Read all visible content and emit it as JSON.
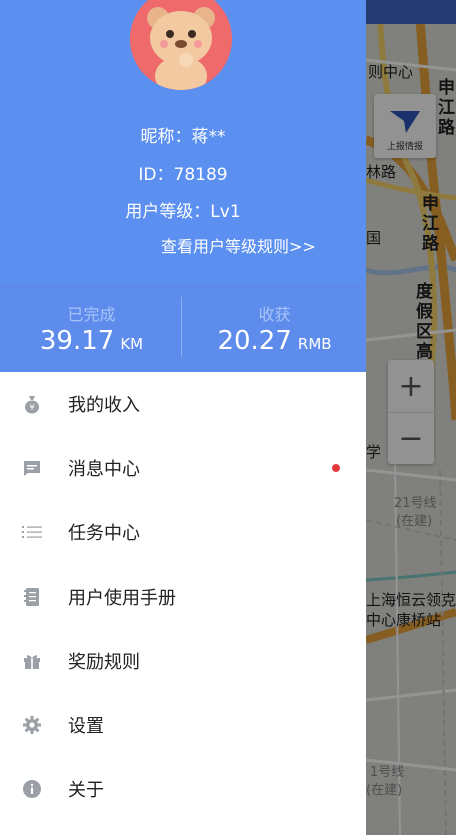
{
  "profile": {
    "nickname": "昵称：蒋**",
    "user_id": "ID：78189",
    "level": "用户等级：Lv1",
    "level_rules_link": "查看用户等级规则>>"
  },
  "stats": {
    "completed": {
      "label": "已完成",
      "value": "39.17",
      "unit": "KM"
    },
    "earned": {
      "label": "收获",
      "value": "20.27",
      "unit": "RMB"
    }
  },
  "menu": {
    "items": [
      {
        "label": "我的收入",
        "icon": "money-bag-icon"
      },
      {
        "label": "消息中心",
        "icon": "message-icon",
        "unread_dot": true
      },
      {
        "label": "任务中心",
        "icon": "list-icon"
      },
      {
        "label": "用户使用手册",
        "icon": "manual-icon"
      },
      {
        "label": "奖励规则",
        "icon": "gift-icon"
      },
      {
        "label": "设置",
        "icon": "gear-icon"
      },
      {
        "label": "关于",
        "icon": "info-icon"
      }
    ]
  },
  "map": {
    "report_button_label": "上报情报",
    "zoom_in": "+",
    "zoom_out": "−",
    "labels": {
      "center_top": "则中心",
      "shenjiang_road_top": "申江路",
      "lin_road": "林路",
      "guo": "国",
      "shenjiang_road_mid": "申江路",
      "resort_overpass": "度假区高架",
      "xue": "学",
      "line21": "21号线",
      "line21_status": "(在建)",
      "station_name_1": "上海恒云领克",
      "station_name_2": "中心康桥站",
      "line1": "1号线",
      "line1_status": "(在建)"
    }
  },
  "colors": {
    "header_blue": "#5b8ff0",
    "unread_dot": "#e23b3b"
  }
}
